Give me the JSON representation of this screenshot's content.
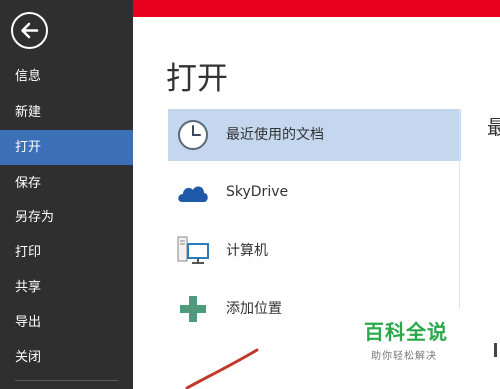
{
  "sidebar": {
    "items": [
      {
        "label": "信息"
      },
      {
        "label": "新建"
      },
      {
        "label": "打开",
        "active": true
      },
      {
        "label": "保存"
      },
      {
        "label": "另存为"
      },
      {
        "label": "打印"
      },
      {
        "label": "共享"
      },
      {
        "label": "导出"
      },
      {
        "label": "关闭"
      }
    ]
  },
  "page": {
    "title": "打开"
  },
  "places": [
    {
      "label": "最近使用的文档",
      "icon": "clock-icon",
      "selected": true
    },
    {
      "label": "SkyDrive",
      "icon": "cloud-icon"
    },
    {
      "label": "计算机",
      "icon": "computer-icon"
    },
    {
      "label": "添加位置",
      "icon": "plus-icon"
    }
  ],
  "right_panel": {
    "heading_partial": "最"
  },
  "watermark": {
    "brand": "百科全说",
    "tagline": "助你轻松解决"
  },
  "colors": {
    "sidebar_bg": "#2f2f2f",
    "active_item": "#3b6fb6",
    "title_strip": "#e8001e",
    "selected_place": "#c5d7ef",
    "watermark_green": "#2ba84a"
  }
}
